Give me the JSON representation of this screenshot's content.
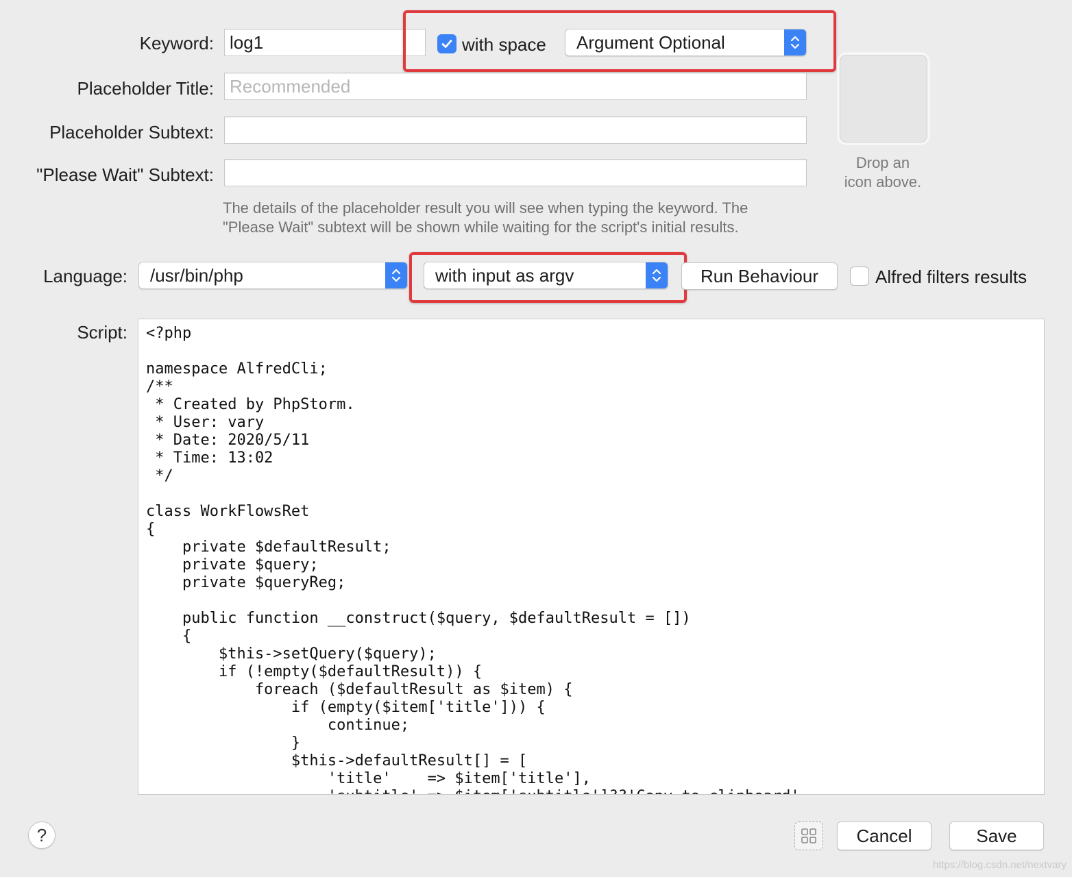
{
  "keyword": {
    "label": "Keyword:",
    "value": "log1",
    "with_space_label": "with space",
    "with_space_checked": true,
    "argument_mode": "Argument Optional"
  },
  "placeholder_title": {
    "label": "Placeholder Title:",
    "placeholder": "Recommended",
    "value": ""
  },
  "placeholder_subtext": {
    "label": "Placeholder Subtext:",
    "value": ""
  },
  "please_wait_subtext": {
    "label": "\"Please Wait\" Subtext:",
    "value": ""
  },
  "help_text": {
    "line1": "The details of the placeholder result you will see when typing the keyword. The",
    "line2": "\"Please Wait\" subtext will be shown while waiting for the script's initial results."
  },
  "icon_drop": {
    "line1": "Drop an",
    "line2": "icon above."
  },
  "language": {
    "label": "Language:",
    "value": "/usr/bin/php",
    "input_mode": "with input as argv",
    "run_behaviour_label": "Run Behaviour",
    "alfred_filters_label": "Alfred filters results",
    "alfred_filters_checked": false
  },
  "script": {
    "label": "Script:",
    "code": "<?php\n\nnamespace AlfredCli;\n/**\n * Created by PhpStorm.\n * User: vary\n * Date: 2020/5/11\n * Time: 13:02\n */\n\nclass WorkFlowsRet\n{\n    private $defaultResult;\n    private $query;\n    private $queryReg;\n\n    public function __construct($query, $defaultResult = [])\n    {\n        $this->setQuery($query);\n        if (!empty($defaultResult)) {\n            foreach ($defaultResult as $item) {\n                if (empty($item['title'])) {\n                    continue;\n                }\n                $this->defaultResult[] = [\n                    'title'    => $item['title'],\n                    'subtitle' => $item['subtitle']??'Copy to clipboard',"
  },
  "footer": {
    "help_symbol": "?",
    "cancel_label": "Cancel",
    "save_label": "Save",
    "watermark": "https://blog.csdn.net/nextvary"
  },
  "colors": {
    "accent": "#3b82f6",
    "highlight": "#e0393e",
    "background": "#ececec"
  }
}
